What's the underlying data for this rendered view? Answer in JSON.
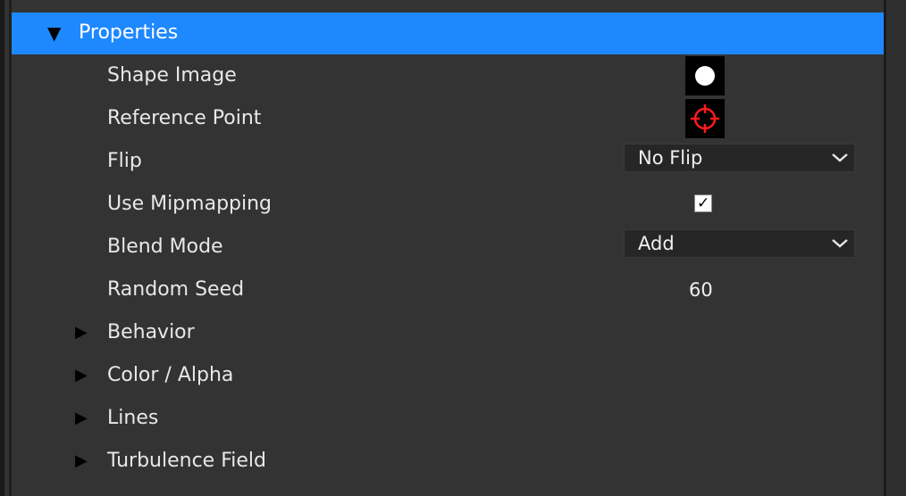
{
  "panel": {
    "header": {
      "label": "Properties",
      "expanded": true
    },
    "properties": [
      {
        "label": "Shape Image",
        "control": "thumbnail",
        "icon": "white-circle-icon"
      },
      {
        "label": "Reference Point",
        "control": "thumbnail",
        "icon": "crosshair-icon"
      },
      {
        "label": "Flip",
        "control": "dropdown",
        "value": "No Flip"
      },
      {
        "label": "Use Mipmapping",
        "control": "checkbox",
        "checked": true
      },
      {
        "label": "Blend Mode",
        "control": "dropdown",
        "value": "Add"
      },
      {
        "label": "Random Seed",
        "control": "number",
        "value": "60"
      }
    ],
    "groups": [
      {
        "label": "Behavior",
        "expanded": false
      },
      {
        "label": "Color / Alpha",
        "expanded": false
      },
      {
        "label": "Lines",
        "expanded": false
      },
      {
        "label": "Turbulence Field",
        "expanded": false
      }
    ]
  },
  "colors": {
    "header_bg": "#1e88ff",
    "panel_bg": "#333333",
    "crosshair": "#ff1a1a"
  }
}
